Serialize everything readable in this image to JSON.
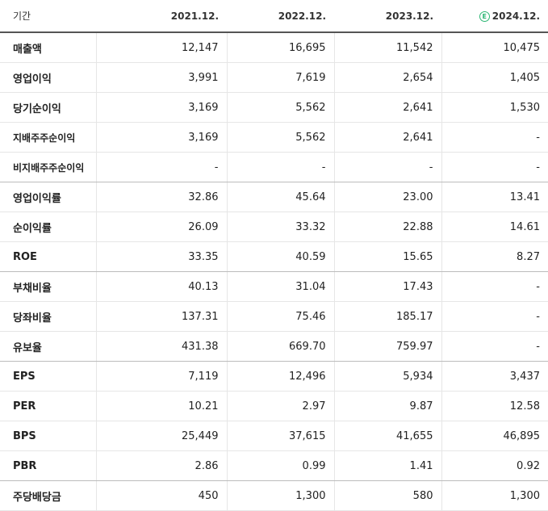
{
  "header": {
    "label": "기간",
    "periods": [
      "2021.12.",
      "2022.12.",
      "2023.12.",
      "2024.12."
    ],
    "estimate_badge": "E",
    "accent_color": "#2bb673"
  },
  "rows": [
    {
      "label": "매출액",
      "values": [
        "12,147",
        "16,695",
        "11,542",
        "10,475"
      ]
    },
    {
      "label": "영업이익",
      "values": [
        "3,991",
        "7,619",
        "2,654",
        "1,405"
      ]
    },
    {
      "label": "당기순이익",
      "values": [
        "3,169",
        "5,562",
        "2,641",
        "1,530"
      ]
    },
    {
      "label": "지배주주순이익",
      "values": [
        "3,169",
        "5,562",
        "2,641",
        "-"
      ]
    },
    {
      "label": "비지배주주순이익",
      "values": [
        "-",
        "-",
        "-",
        "-"
      ]
    },
    {
      "label": "영업이익률",
      "values": [
        "32.86",
        "45.64",
        "23.00",
        "13.41"
      ]
    },
    {
      "label": "순이익률",
      "values": [
        "26.09",
        "33.32",
        "22.88",
        "14.61"
      ]
    },
    {
      "label": "ROE",
      "values": [
        "33.35",
        "40.59",
        "15.65",
        "8.27"
      ]
    },
    {
      "label": "부채비율",
      "values": [
        "40.13",
        "31.04",
        "17.43",
        "-"
      ]
    },
    {
      "label": "당좌비율",
      "values": [
        "137.31",
        "75.46",
        "185.17",
        "-"
      ]
    },
    {
      "label": "유보율",
      "values": [
        "431.38",
        "669.70",
        "759.97",
        "-"
      ]
    },
    {
      "label": "EPS",
      "values": [
        "7,119",
        "12,496",
        "5,934",
        "3,437"
      ]
    },
    {
      "label": "PER",
      "values": [
        "10.21",
        "2.97",
        "9.87",
        "12.58"
      ]
    },
    {
      "label": "BPS",
      "values": [
        "25,449",
        "37,615",
        "41,655",
        "46,895"
      ]
    },
    {
      "label": "PBR",
      "values": [
        "2.86",
        "0.99",
        "1.41",
        "0.92"
      ]
    },
    {
      "label": "주당배당금",
      "values": [
        "450",
        "1,300",
        "580",
        "1,300"
      ]
    }
  ]
}
